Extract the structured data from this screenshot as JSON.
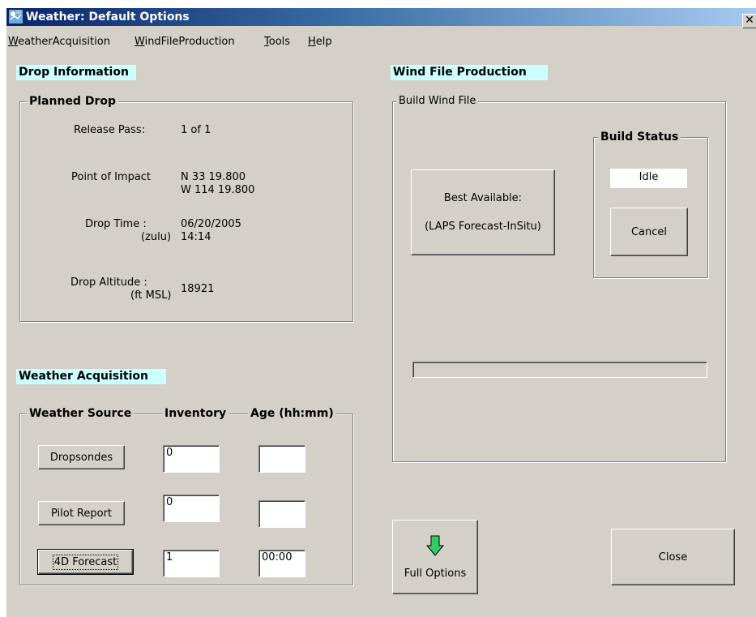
{
  "window": {
    "title": "Weather: Default Options",
    "close_symbol": "✕"
  },
  "menu": [
    {
      "label": "WeatherAcquisition",
      "accel": "W",
      "rest": "eatherAcquisition"
    },
    {
      "label": "WindFileProduction",
      "accel": "W",
      "rest": "indFileProduction"
    },
    {
      "label": "Tools",
      "accel": "T",
      "rest": "ools"
    },
    {
      "label": "Help",
      "accel": "H",
      "rest": "elp"
    }
  ],
  "drop_info": {
    "header": "Drop Information",
    "group_title": "Planned Drop",
    "release_pass_label": "Release Pass:",
    "release_pass_value": "1 of 1",
    "poi_label": "Point of Impact",
    "poi_lat": "N 33 19.800",
    "poi_lon": "W 114 19.800",
    "drop_time_label": "Drop Time :",
    "drop_time_unit": "(zulu)",
    "drop_time_date": "06/20/2005",
    "drop_time_time": "14:14",
    "drop_alt_label": "Drop Altitude :",
    "drop_alt_unit": "(ft MSL)",
    "drop_alt_value": "18921"
  },
  "weather_acq": {
    "header": "Weather Acquisition",
    "col_source": "Weather  Source",
    "col_inventory": "Inventory",
    "col_age": "Age (hh:mm)",
    "rows": [
      {
        "button": "Dropsondes",
        "inventory": "0",
        "age": ""
      },
      {
        "button": "Pilot Report",
        "inventory": "0",
        "age": ""
      },
      {
        "button": "4D Forecast",
        "inventory": "1",
        "age": "00:00"
      }
    ]
  },
  "wind_file": {
    "header": "Wind File Production",
    "group_title": "Build Wind File",
    "best_line1": "Best Available:",
    "best_line2": "(LAPS Forecast-InSitu)",
    "status_title": "Build Status",
    "status_value": "Idle",
    "cancel": "Cancel",
    "progress": 0
  },
  "footer": {
    "full_options": "Full Options",
    "close": "Close"
  },
  "colors": {
    "face": "#d4d0c8",
    "header_bg": "#ccffff",
    "arrow": "#33cc66"
  }
}
